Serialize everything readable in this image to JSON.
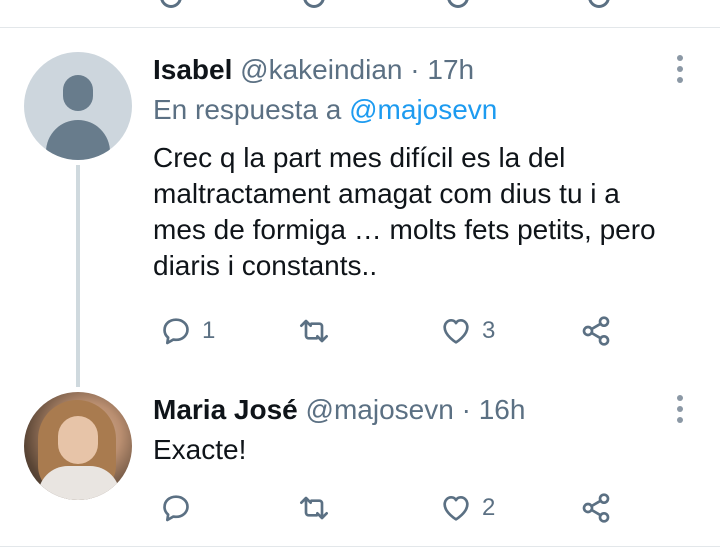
{
  "thread": [
    {
      "name": "Isabel",
      "handle": "@kakeindian",
      "time": "17h",
      "reply_prefix": "En respuesta a",
      "reply_handle": "@majosevn",
      "lines": [
        "Crec q la part mes difícil es la del",
        "maltractament amagat com dius tu i a",
        "mes de formiga … molts fets petits, pero",
        "diaris i constants.."
      ],
      "replies": "1",
      "retweets": "",
      "likes": "3"
    },
    {
      "name": "Maria José",
      "handle": "@majosevn",
      "time": "16h",
      "lines": [
        "Exacte!"
      ],
      "replies": "",
      "retweets": "",
      "likes": "2"
    }
  ],
  "separator": "·",
  "icons": {
    "reply": "reply-icon",
    "retweet": "retweet-icon",
    "like": "heart-icon",
    "share": "share-icon",
    "more": "more-vertical-icon",
    "default_avatar": "default-avatar-icon"
  },
  "colors": {
    "text": "#0f1419",
    "muted": "#5b7083",
    "link": "#1d9bf0",
    "border": "#e3e7ea"
  }
}
